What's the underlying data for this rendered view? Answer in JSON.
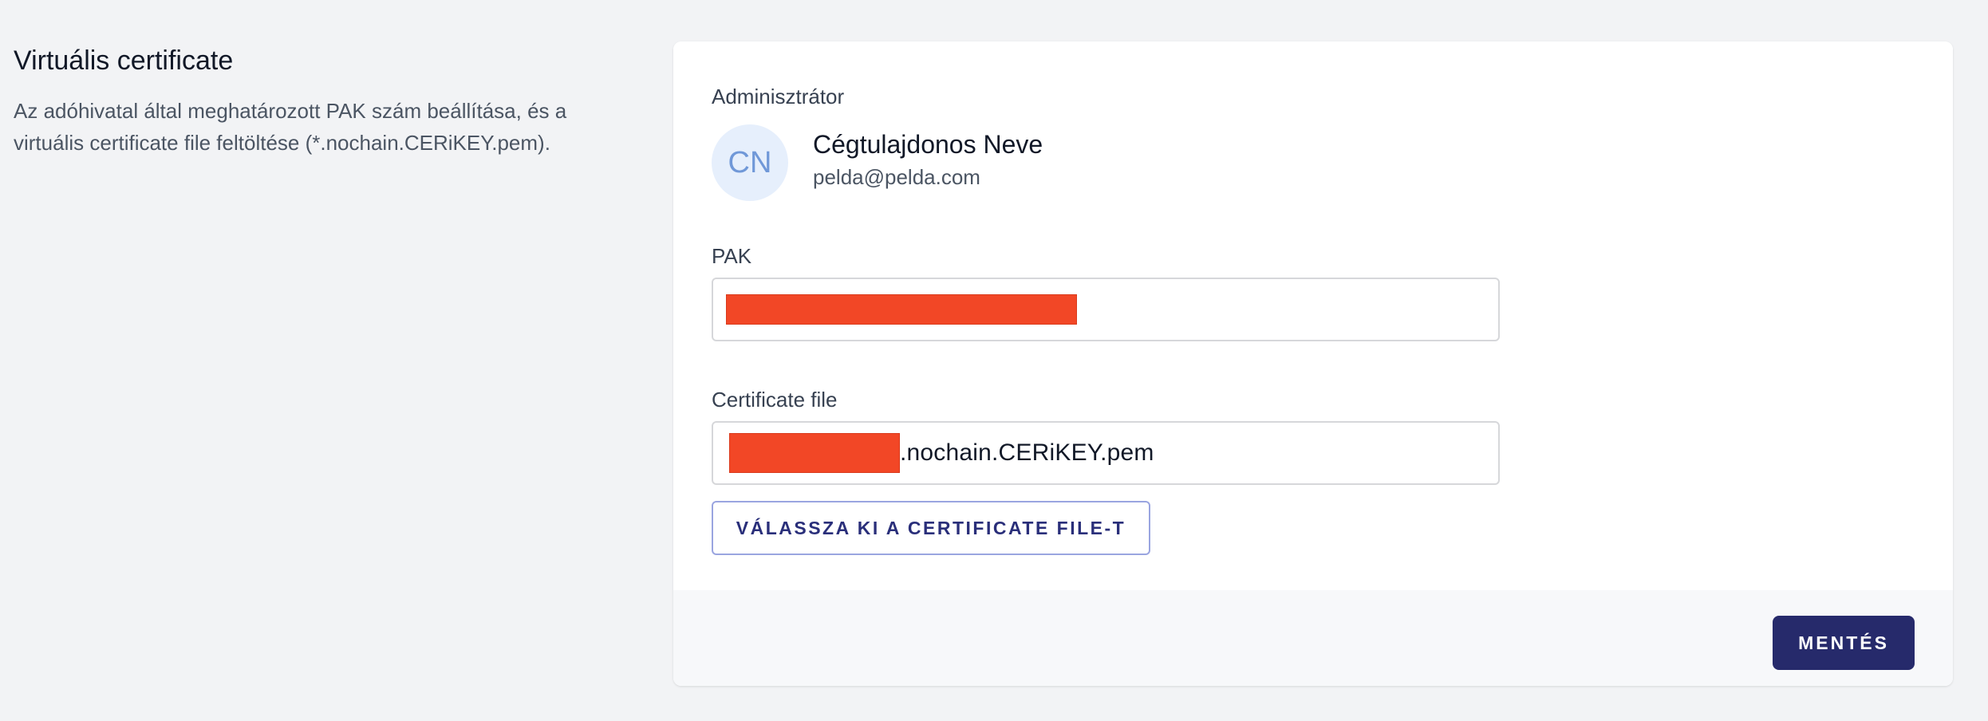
{
  "section": {
    "title": "Virtuális certificate",
    "description_line1": "Az adóhivatal által meghatározott PAK szám beállítása, és a",
    "description_line2": "virtuális certificate file feltöltése (*.nochain.CERiKEY.pem)."
  },
  "admin": {
    "label": "Adminisztrátor",
    "initials": "CN",
    "name": "Cégtulajdonos Neve",
    "email": "pelda@pelda.com"
  },
  "pak": {
    "label": "PAK",
    "value": ""
  },
  "certificate": {
    "label": "Certificate file",
    "value_suffix": ".nochain.CERiKEY.pem",
    "choose_label": "VÁLASSZA KI A CERTIFICATE FILE-T"
  },
  "footer": {
    "save_label": "MENTÉS"
  },
  "colors": {
    "page_bg": "#f2f3f5",
    "card_bg": "#ffffff",
    "footer_bg": "#f7f8fa",
    "primary": "#262a6b",
    "avatar_bg": "#e6effc",
    "avatar_text": "#7098d8",
    "redaction": "#f24726"
  }
}
